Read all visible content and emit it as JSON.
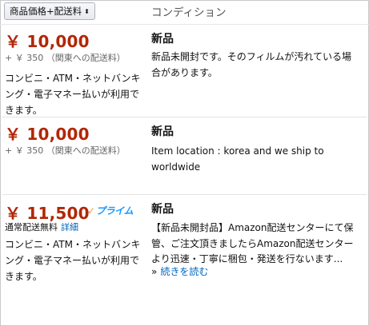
{
  "header": {
    "sort_label": "商品価格+配送料",
    "sort_caret": "⬍",
    "condition_header": "コンディション"
  },
  "offers": [
    {
      "price": "￥ 10,000",
      "shipping": "+ ￥ 350 （関東への配送料）",
      "payment": "コンビニ・ATM・ネットバンキング・電子マネー払いが利用できます。",
      "condition": "新品",
      "description": "新品未開封です。そのフィルムが汚れている場合があります。"
    },
    {
      "price": "￥ 10,000",
      "shipping": "+ ￥ 350 （関東への配送料）",
      "condition": "新品",
      "description": "Item location : korea and we ship to worldwide"
    },
    {
      "price": "￥ 11,500",
      "prime_badge": "プライム",
      "free_shipping": "通常配送無料",
      "free_shipping_details": "詳細",
      "payment": "コンビニ・ATM・ネットバンキング・電子マネー払いが利用できます。",
      "condition": "新品",
      "description": "【新品未開封品】Amazon配送センターにて保管、ご注文頂きましたらAmazon配送センターより迅速・丁寧に梱包・発送を行ないます...",
      "read_more_prefix": "»",
      "read_more": "続きを読む"
    }
  ],
  "colors": {
    "price": "#b12704",
    "link": "#0066c0",
    "prime_blue": "#1a98ff",
    "prime_check": "#f6a21b"
  },
  "icons": {
    "sort_caret": "sort-caret-icon",
    "prime_check": "prime-check-icon"
  }
}
